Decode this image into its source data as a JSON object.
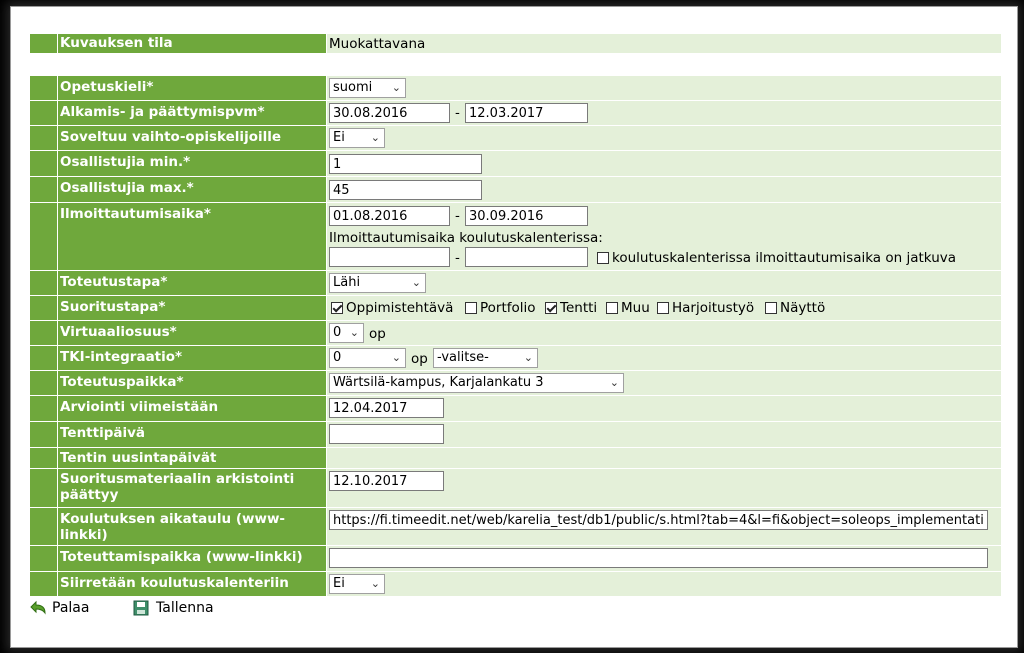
{
  "form": {
    "status": {
      "label": "Kuvauksen tila",
      "value": "Muokattavana"
    },
    "teaching_language": {
      "label": "Opetuskieli*",
      "value": "suomi"
    },
    "dates": {
      "label": "Alkamis- ja päättymispvm*",
      "start": "30.08.2016",
      "end": "12.03.2017",
      "separator": "-"
    },
    "exchange": {
      "label": "Soveltuu vaihto-opiskelijoille",
      "value": "Ei"
    },
    "min_participants": {
      "label": "Osallistujia min.*",
      "value": "1"
    },
    "max_participants": {
      "label": "Osallistujia max.*",
      "value": "45"
    },
    "enrollment": {
      "label": "Ilmoittautumisaika*",
      "start": "01.08.2016",
      "end": "30.09.2016",
      "separator": "-",
      "calendar_label": "Ilmoittautumisaika koulutuskalenterissa:",
      "calendar_start": "",
      "calendar_end": "",
      "continuous_label": "koulutuskalenterissa ilmoittautumisaika on jatkuva",
      "continuous_checked": false
    },
    "implementation_method": {
      "label": "Toteutustapa*",
      "value": "Lähi"
    },
    "completion_method": {
      "label": "Suoritustapa*",
      "options": [
        {
          "label": "Oppimistehtävä",
          "checked": true
        },
        {
          "label": "Portfolio",
          "checked": false
        },
        {
          "label": "Tentti",
          "checked": true
        },
        {
          "label": "Muu",
          "checked": false
        },
        {
          "label": "Harjoitustyö",
          "checked": false
        },
        {
          "label": "Näyttö",
          "checked": false
        }
      ]
    },
    "virtuality": {
      "label": "Virtuaaliosuus*",
      "value": "0",
      "unit": "op"
    },
    "tki": {
      "label": "TKI-integraatio*",
      "value": "0",
      "unit": "op",
      "type": "-valitse-"
    },
    "location": {
      "label": "Toteutuspaikka*",
      "value": "Wärtsilä-kampus, Karjalankatu 3"
    },
    "assessment_by": {
      "label": "Arviointi viimeistään",
      "value": "12.04.2017"
    },
    "exam_day": {
      "label": "Tenttipäivä",
      "value": ""
    },
    "retake_days": {
      "label": "Tentin uusintapäivät"
    },
    "archive_end": {
      "label": "Suoritusmateriaalin arkistointi päättyy",
      "value": "12.10.2017"
    },
    "schedule_link": {
      "label": "Koulutuksen aikataulu (www-linkki)",
      "value": "https://fi.timeedit.net/web/karelia_test/db1/public/s.html?tab=4&l=fi&object=soleops_implementation_"
    },
    "venue_link": {
      "label": "Toteuttamispaikka (www-linkki)",
      "value": ""
    },
    "transfer_calendar": {
      "label": "Siirretään koulutuskalenteriin",
      "value": "Ei"
    }
  },
  "actions": {
    "back_label": "Palaa",
    "save_label": "Tallenna"
  },
  "icons": {
    "back": "back-arrow-icon",
    "save": "floppy-disk-icon"
  },
  "colors": {
    "label_bg": "#6fa83c",
    "value_bg": "#e4f0d9"
  }
}
